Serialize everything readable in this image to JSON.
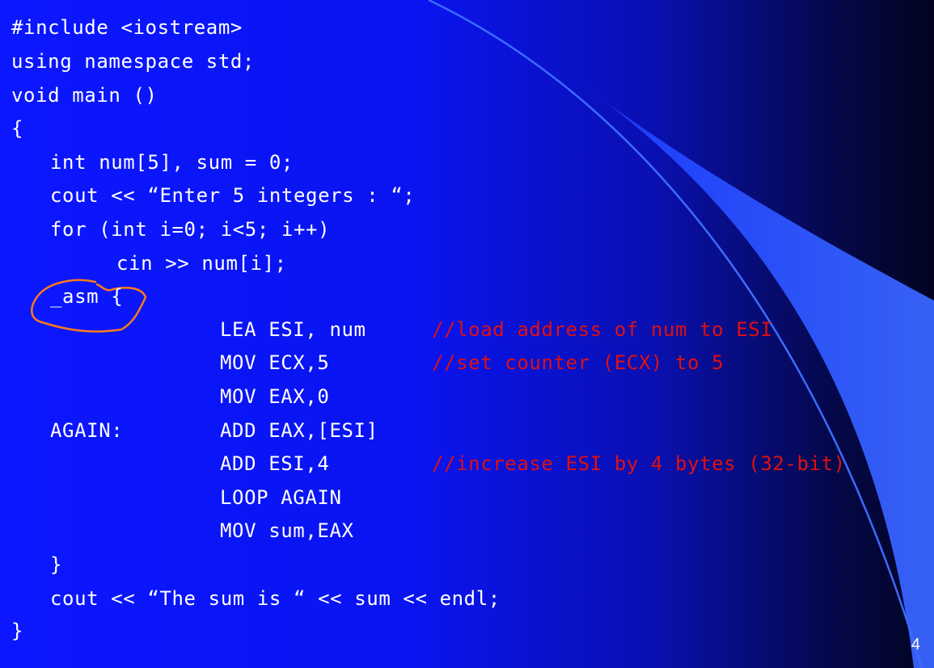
{
  "slide": {
    "page_number": "4",
    "accent_colors": {
      "background_left": "#0b17ff",
      "background_right": "#020420",
      "swoosh": "#3a63ff",
      "comment": "#e01010",
      "annotation_circle": "#ff7a1a"
    }
  },
  "code": {
    "l1": "#include <iostream>",
    "l2": "using namespace std;",
    "l3": "void main ()",
    "l4": "{",
    "l5": "int num[5], sum = 0;",
    "l6": "cout << “Enter 5 integers : “;",
    "l7": "for (int i=0; i<5; i++)",
    "l8": "cin >> num[i];",
    "l9": "_asm {",
    "l10": "LEA ESI, num",
    "l11": "MOV ECX,5",
    "l12": "MOV EAX,0",
    "l13_label": "AGAIN:",
    "l13": "ADD EAX,[ESI]",
    "l14": "ADD ESI,4",
    "l15": "LOOP AGAIN",
    "l16": "MOV sum,EAX",
    "l17": "}",
    "l18": "cout << “The sum is “ << sum << endl;",
    "l19": "}"
  },
  "comments": {
    "c1": "//load address of num to ESI",
    "c2": "//set counter (ECX) to 5",
    "c3": "//increase ESI by 4 bytes (32-bit)"
  }
}
